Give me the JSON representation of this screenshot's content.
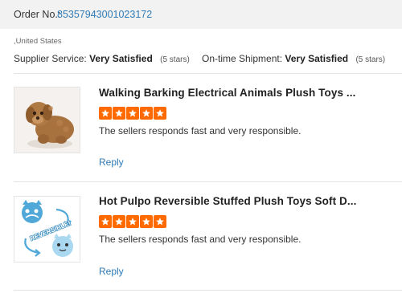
{
  "order": {
    "label": "Order No.:",
    "number": "8535794300102317​2"
  },
  "buyer": {
    "country": ",United States"
  },
  "ratings": {
    "supplier_service": {
      "label": "Supplier Service:",
      "value": "Very Satisfied",
      "stars": "(5 stars)"
    },
    "ontime_shipment": {
      "label": "On-time Shipment:",
      "value": "Very Satisfied",
      "stars": "(5 stars)"
    }
  },
  "reviews": [
    {
      "title": "Walking Barking Electrical Animals Plush Toys ...",
      "rating": 5,
      "text": "The sellers responds fast and very responsible.",
      "reply_label": "Reply",
      "thumbnail": "brown-plush-puppy"
    },
    {
      "title": "Hot Pulpo Reversible Stuffed Plush Toys Soft D...",
      "rating": 5,
      "text": "The sellers responds fast and very responsible.",
      "reply_label": "Reply",
      "thumbnail": "blue-reversible-plush",
      "thumbnail_text": "REVERSIBLE!"
    }
  ],
  "colors": {
    "accent_link": "#2f7ab5",
    "star": "#ff6a00",
    "header_bg": "#f2f2f2"
  }
}
